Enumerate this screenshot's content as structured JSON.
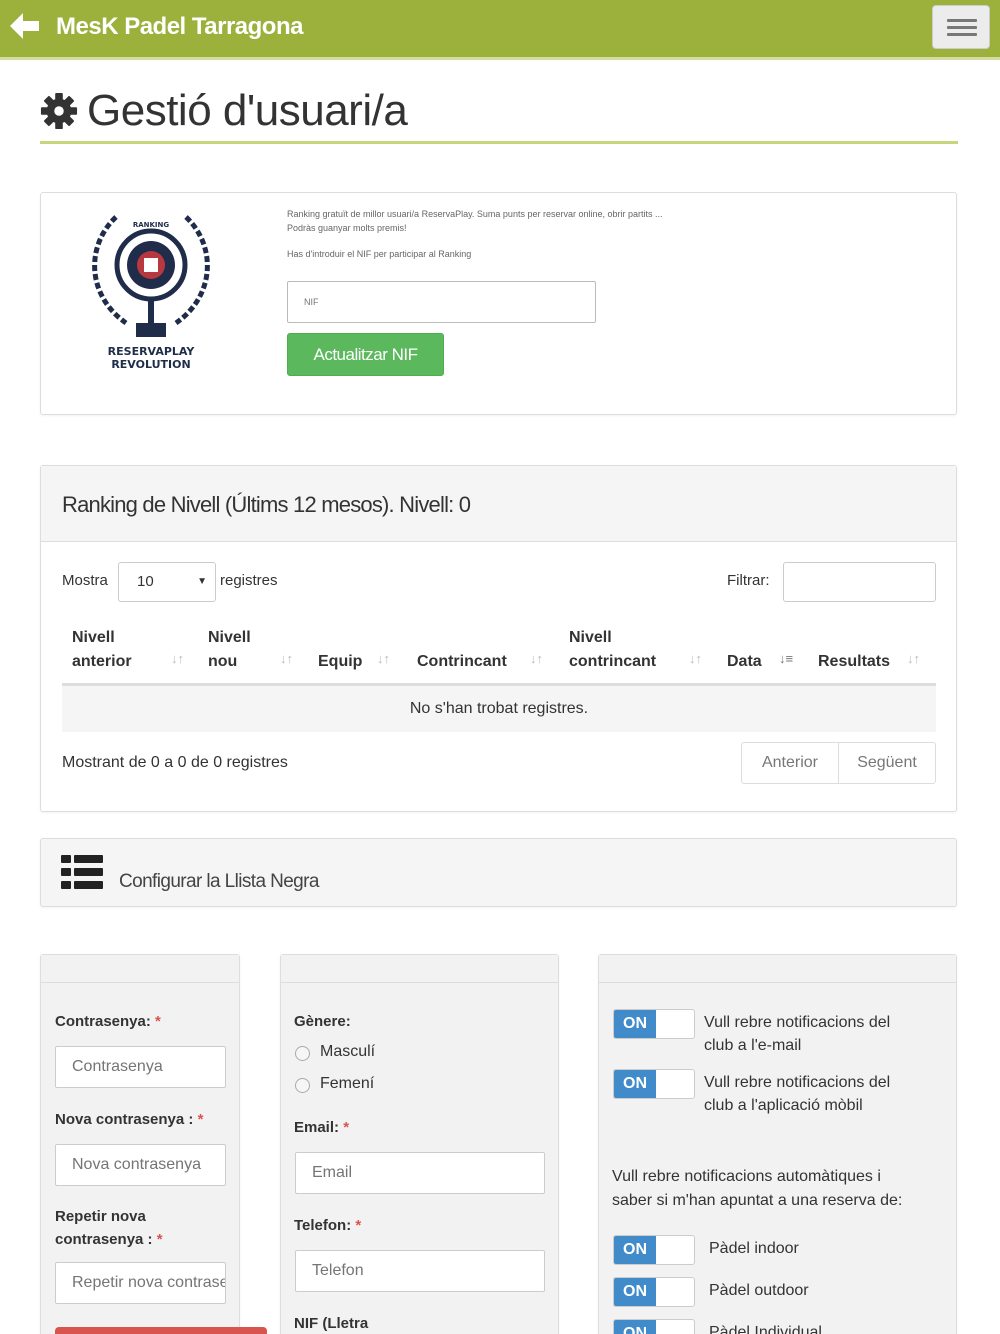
{
  "app": {
    "title": "MesK Padel Tarragona"
  },
  "page": {
    "title": "Gestió d'usuari/a"
  },
  "ranking": {
    "logo_lines": [
      "RANKING",
      "RESERVAPLAY",
      "REVOLUTION"
    ],
    "text_line1": "Ranking gratuït de millor usuari/a ReservaPlay. Suma punts per reservar online, obrir partits ...",
    "text_line2": "Podràs guanyar molts premis!",
    "text_line3": "Has d'introduir el NIF per participar al Ranking",
    "nif_placeholder": "NIF",
    "update_button": "Actualitzar NIF"
  },
  "level": {
    "header": "Ranking de Nivell (Últims 12 mesos). Nivell: 0",
    "show_label": "Mostra",
    "page_size": "10",
    "records_label": "registres",
    "filter_label": "Filtrar:",
    "columns": [
      {
        "l1": "Nivell",
        "l2": "anterior"
      },
      {
        "l1": "Nivell",
        "l2": "nou"
      },
      {
        "l1": "",
        "l2": "Equip"
      },
      {
        "l1": "",
        "l2": "Contrincant"
      },
      {
        "l1": "Nivell",
        "l2": "contrincant"
      },
      {
        "l1": "",
        "l2": "Data"
      },
      {
        "l1": "",
        "l2": "Resultats"
      }
    ],
    "empty_message": "No s'han trobat registres.",
    "footer_info": "Mostrant de 0 a 0 de 0 registres",
    "prev_label": "Anterior",
    "next_label": "Següent"
  },
  "blacklist": {
    "label": "Configurar la Llista Negra"
  },
  "password_form": {
    "password_label": "Contrasenya:",
    "password_placeholder": "Contrasenya",
    "new_password_label": "Nova contrasenya :",
    "new_password_placeholder": "Nova contrasenya",
    "repeat_label_1": "Repetir nova",
    "repeat_label_2": "contrasenya :",
    "repeat_placeholder": "Repetir nova contrasenya",
    "required_mark": "*"
  },
  "profile_form": {
    "gender_label": "Gènere:",
    "male": "Masculí",
    "female": "Femení",
    "email_label": "Email:",
    "email_placeholder": "Email",
    "phone_label": "Telefon:",
    "phone_placeholder": "Telefon",
    "nif_label": "NIF (Lletra",
    "required_mark": "*"
  },
  "notifications": {
    "on_label": "ON",
    "email_line1": "Vull rebre notificacions del",
    "email_line2": "club a l'e-mail",
    "app_line1": "Vull rebre notificacions del",
    "app_line2": "club a l'aplicació mòbil",
    "auto_line1": "Vull rebre notificacions automàtiques i",
    "auto_line2": "saber si m'han apuntat a una reserva de:",
    "sports": [
      "Pàdel indoor",
      "Pàdel outdoor",
      "Pàdel Individual"
    ]
  },
  "colors": {
    "topbar": "#9bb13b",
    "green_button": "#5cb85c",
    "toggle_on": "#428bca",
    "required": "#d9534f"
  }
}
